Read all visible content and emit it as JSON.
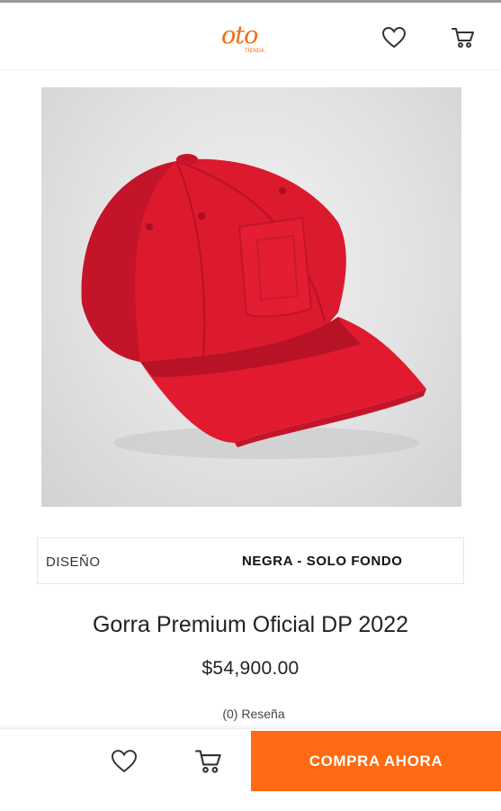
{
  "header": {
    "logo_text": "oto",
    "logo_sub": "TIENDA",
    "favorites_icon": "heart-icon",
    "cart_icon": "cart-icon"
  },
  "product": {
    "image_alt": "red-cap-image",
    "variant": {
      "label": "DISEÑO",
      "value": "NEGRA - SOLO FONDO"
    },
    "title": "Gorra Premium Oficial DP 2022",
    "price": "$54,900.00",
    "reviews": "(0) Reseña"
  },
  "bottom_bar": {
    "favorite_icon": "heart-icon",
    "cart_icon": "cart-icon",
    "buy_label": "COMPRA AHORA"
  },
  "colors": {
    "accent": "#ff6a13",
    "logo": "#f26c14",
    "cap": "#e3172e"
  }
}
